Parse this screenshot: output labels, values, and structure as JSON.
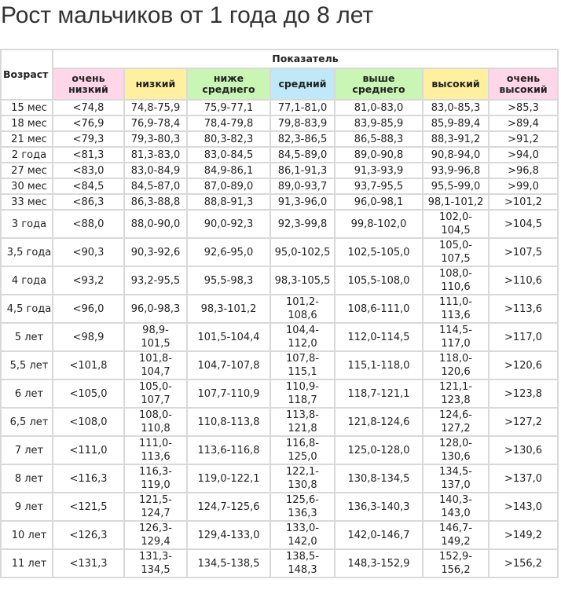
{
  "title": "Рост мальчиков от 1 года до 8 лет",
  "table": {
    "age_header": "Возраст",
    "group_header": "Показатель",
    "columns": [
      {
        "label": "очень низкий",
        "color": "#ffd7e8"
      },
      {
        "label": "низкий",
        "color": "#fff0a0"
      },
      {
        "label": "ниже среднего",
        "color": "#c9f5b5"
      },
      {
        "label": "средний",
        "color": "#bfe8f8"
      },
      {
        "label": "выше среднего",
        "color": "#c9f5b5"
      },
      {
        "label": "высокий",
        "color": "#fff0a0"
      },
      {
        "label": "очень высокий",
        "color": "#ffd7e8"
      }
    ],
    "rows": [
      [
        "15 мес",
        "<74,8",
        "74,8-75,9",
        "75,9-77,1",
        "77,1-81,0",
        "81,0-83,0",
        "83,0-85,3",
        ">85,3"
      ],
      [
        "18 мес",
        "<76,9",
        "76,9-78,4",
        "78,4-79,8",
        "79,8-83,9",
        "83,9-85,9",
        "85,9-89,4",
        ">89,4"
      ],
      [
        "21 мес",
        "<79,3",
        "79,3-80,3",
        "80,3-82,3",
        "82,3-86,5",
        "86,5-88,3",
        "88,3-91,2",
        ">91,2"
      ],
      [
        "2 года",
        "<81,3",
        "81,3-83,0",
        "83,0-84,5",
        "84,5-89,0",
        "89,0-90,8",
        "90,8-94,0",
        ">94,0"
      ],
      [
        "27 мес",
        "<83,0",
        "83,0-84,9",
        "84,9-86,1",
        "86,1-91,3",
        "91,3-93,9",
        "93,9-96,8",
        ">96,8"
      ],
      [
        "30 мес",
        "<84,5",
        "84,5-87,0",
        "87,0-89,0",
        "89,0-93,7",
        "93,7-95,5",
        "95,5-99,0",
        ">99,0"
      ],
      [
        "33 мес",
        "<86,3",
        "86,3-88,8",
        "88,8-91,3",
        "91,3-96,0",
        "96,0-98,1",
        "98,1-101,2",
        ">101,2"
      ],
      [
        "3 года",
        "<88,0",
        "88,0-90,0",
        "90,0-92,3",
        "92,3-99,8",
        "99,8-102,0",
        "102,0-\n104,5",
        ">104,5"
      ],
      [
        "3,5 года",
        "<90,3",
        "90,3-92,6",
        "92,6-95,0",
        "95,0-102,5",
        "102,5-105,0",
        "105,0-\n107,5",
        ">107,5"
      ],
      [
        "4 года",
        "<93,2",
        "93,2-95,5",
        "95,5-98,3",
        "98,3-105,5",
        "105,5-108,0",
        "108,0-\n110,6",
        ">110,6"
      ],
      [
        "4,5 года",
        "<96,0",
        "96,0-98,3",
        "98,3-101,2",
        "101,2-\n108,6",
        "108,6-111,0",
        "111,0-\n113,6",
        ">113,6"
      ],
      [
        "5 лет",
        "<98,9",
        "98,9-\n101,5",
        "101,5-104,4",
        "104,4-\n112,0",
        "112,0-114,5",
        "114,5-\n117,0",
        ">117,0"
      ],
      [
        "5,5 лет",
        "<101,8",
        "101,8-\n104,7",
        "104,7-107,8",
        "107,8-\n115,1",
        "115,1-118,0",
        "118,0-\n120,6",
        ">120,6"
      ],
      [
        "6 лет",
        "<105,0",
        "105,0-\n107,7",
        "107,7-110,9",
        "110,9-\n118,7",
        "118,7-121,1",
        "121,1-\n123,8",
        ">123,8"
      ],
      [
        "6,5 лет",
        "<108,0",
        "108,0-\n110,8",
        "110,8-113,8",
        "113,8-\n121,8",
        "121,8-124,6",
        "124,6-\n127,2",
        ">127,2"
      ],
      [
        "7 лет",
        "<111,0",
        "111,0-\n113,6",
        "113,6-116,8",
        "116,8-\n125,0",
        "125,0-128,0",
        "128,0-\n130,6",
        ">130,6"
      ],
      [
        "8 лет",
        "<116,3",
        "116,3-\n119,0",
        "119,0-122,1",
        "122,1-\n130,8",
        "130,8-134,5",
        "134,5-\n137,0",
        ">137,0"
      ],
      [
        "9 лет",
        "<121,5",
        "121,5-\n124,7",
        "124,7-125,6",
        "125,6-\n136,3",
        "136,3-140,3",
        "140,3-\n143,0",
        ">143,0"
      ],
      [
        "10 лет",
        "<126,3",
        "126,3-\n129,4",
        "129,4-133,0",
        "133,0-\n142,0",
        "142,0-146,7",
        "146,7-\n149,2",
        ">149,2"
      ],
      [
        "11 лет",
        "<131,3",
        "131,3-\n134,5",
        "134,5-138,5",
        "138,5-\n148,3",
        "148,3-152,9",
        "152,9-\n156,2",
        ">156,2"
      ]
    ]
  }
}
